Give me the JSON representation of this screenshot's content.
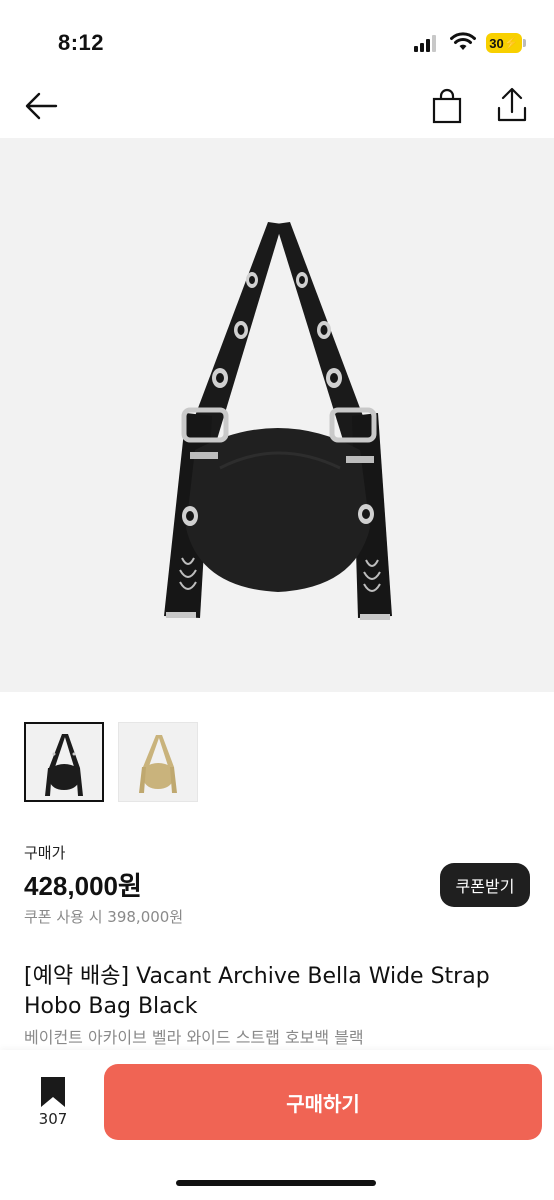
{
  "status": {
    "time": "8:12",
    "battery": "30"
  },
  "nav": {
    "back_icon": "arrow-left-icon",
    "bag_icon": "shopping-bag-icon",
    "share_icon": "share-icon"
  },
  "product": {
    "image_icon": "black-hobo-bag-image",
    "thumbnails": [
      {
        "name": "black-bag-thumbnail",
        "color": "#1c1c1c",
        "selected": true
      },
      {
        "name": "beige-bag-thumbnail",
        "color": "#c9b37c",
        "selected": false
      }
    ],
    "price_label": "구매가",
    "price": "428,000원",
    "coupon_price": "쿠폰 사용 시 398,000원",
    "coupon_button": "쿠폰받기",
    "title": "[예약 배송] Vacant Archive Bella Wide Strap Hobo Bag Black",
    "subtitle": "베이컨트 아카이브 벨라 와이드 스트랩 호보백 블랙"
  },
  "bottom": {
    "bookmark_count": "307",
    "buy_button": "구매하기"
  },
  "colors": {
    "buy": "#f06454",
    "coupon_button": "#1f1f1f",
    "battery": "#f8d000",
    "hero_bg": "#f2f2f2"
  }
}
